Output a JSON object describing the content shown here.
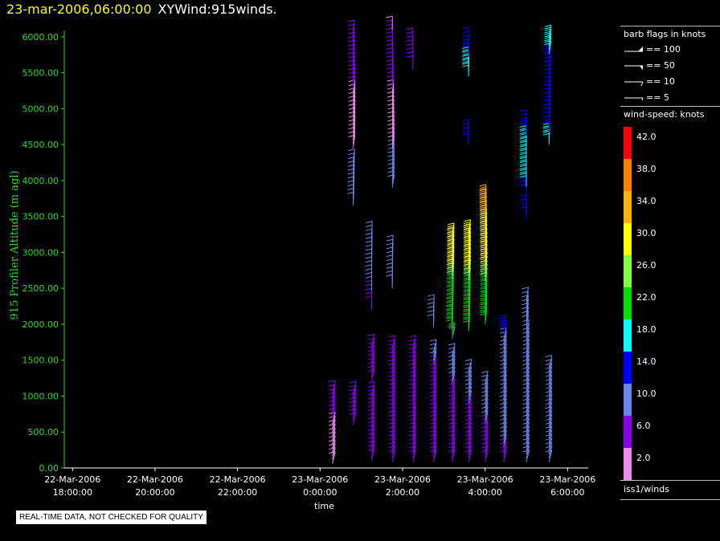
{
  "header": {
    "timestamp": "23-mar-2006,06:00:00",
    "title": "XYWind:915winds."
  },
  "legend": {
    "flags_title": "barb flags in knots",
    "flags": [
      "== 100",
      "== 50",
      "== 10",
      "== 5"
    ],
    "colorbar_title": "wind-speed: knots",
    "colorbar": [
      {
        "label": "42.0",
        "color": "#ff0000"
      },
      {
        "label": "38.0",
        "color": "#ff8000"
      },
      {
        "label": "34.0",
        "color": "#ffb000"
      },
      {
        "label": "30.0",
        "color": "#ffff00"
      },
      {
        "label": "26.0",
        "color": "#80ff40"
      },
      {
        "label": "22.0",
        "color": "#00dd00"
      },
      {
        "label": "18.0",
        "color": "#00ffff"
      },
      {
        "label": "14.0",
        "color": "#0000ff"
      },
      {
        "label": "10.0",
        "color": "#6688ee"
      },
      {
        "label": "6.0",
        "color": "#8800ee"
      },
      {
        "label": "2.0",
        "color": "#ee88ee"
      }
    ],
    "source": "iss1/winds"
  },
  "footer_note": "REAL-TIME DATA, NOT CHECKED FOR QUALITY",
  "chart_data": {
    "type": "scatter",
    "ylabel": "915 Profiler Altitude (m agl)",
    "xlabel": "time",
    "ylim": [
      0,
      6200
    ],
    "yticks": [
      "0.00",
      "500.00",
      "1000.00",
      "1500.00",
      "2000.00",
      "2500.00",
      "3000.00",
      "3500.00",
      "4000.00",
      "4500.00",
      "5000.00",
      "5500.00",
      "6000.00"
    ],
    "xlim": [
      -6.2,
      6.5
    ],
    "xticks": [
      {
        "x": -6,
        "date": "22-Mar-2006",
        "time": "18:00:00"
      },
      {
        "x": -4,
        "date": "22-Mar-2006",
        "time": "20:00:00"
      },
      {
        "x": -2,
        "date": "22-Mar-2006",
        "time": "22:00:00"
      },
      {
        "x": 0,
        "date": "23-Mar-2006",
        "time": "0:00:00"
      },
      {
        "x": 2,
        "date": "23-Mar-2006",
        "time": "2:00:00"
      },
      {
        "x": 4,
        "date": "23-Mar-2006",
        "time": "4:00:00"
      },
      {
        "x": 6,
        "date": "23-Mar-2006",
        "time": "6:00:00"
      }
    ],
    "columns": [
      {
        "t": 0.3,
        "segs": [
          [
            60,
            1050
          ]
        ]
      },
      {
        "t": 0.8,
        "segs": [
          [
            600,
            1050
          ],
          [
            3650,
            4300
          ],
          [
            4450,
            6050
          ]
        ]
      },
      {
        "t": 1.25,
        "segs": [
          [
            100,
            1050
          ],
          [
            1200,
            1700
          ],
          [
            2200,
            3250
          ]
        ]
      },
      {
        "t": 1.75,
        "segs": [
          [
            80,
            1700
          ],
          [
            2500,
            3050
          ],
          [
            3900,
            6150
          ]
        ]
      },
      {
        "t": 2.25,
        "segs": [
          [
            80,
            1700
          ],
          [
            5550,
            5950
          ]
        ]
      },
      {
        "t": 2.75,
        "segs": [
          [
            80,
            1650
          ],
          [
            1950,
            2250
          ]
        ]
      },
      {
        "t": 3.2,
        "segs": [
          [
            80,
            1600
          ],
          [
            1800,
            3250
          ]
        ]
      },
      {
        "t": 3.6,
        "segs": [
          [
            80,
            1350
          ],
          [
            1900,
            3300
          ],
          [
            4500,
            4700
          ],
          [
            5450,
            5950
          ]
        ]
      },
      {
        "t": 4.0,
        "segs": [
          [
            80,
            1200
          ],
          [
            2000,
            3800
          ]
        ]
      },
      {
        "t": 4.45,
        "segs": [
          [
            80,
            1950
          ]
        ]
      },
      {
        "t": 5.0,
        "segs": [
          [
            80,
            2350
          ],
          [
            3450,
            3650
          ],
          [
            3750,
            4800
          ]
        ]
      },
      {
        "t": 5.55,
        "segs": [
          [
            80,
            1450
          ],
          [
            4500,
            6000
          ]
        ]
      }
    ]
  }
}
